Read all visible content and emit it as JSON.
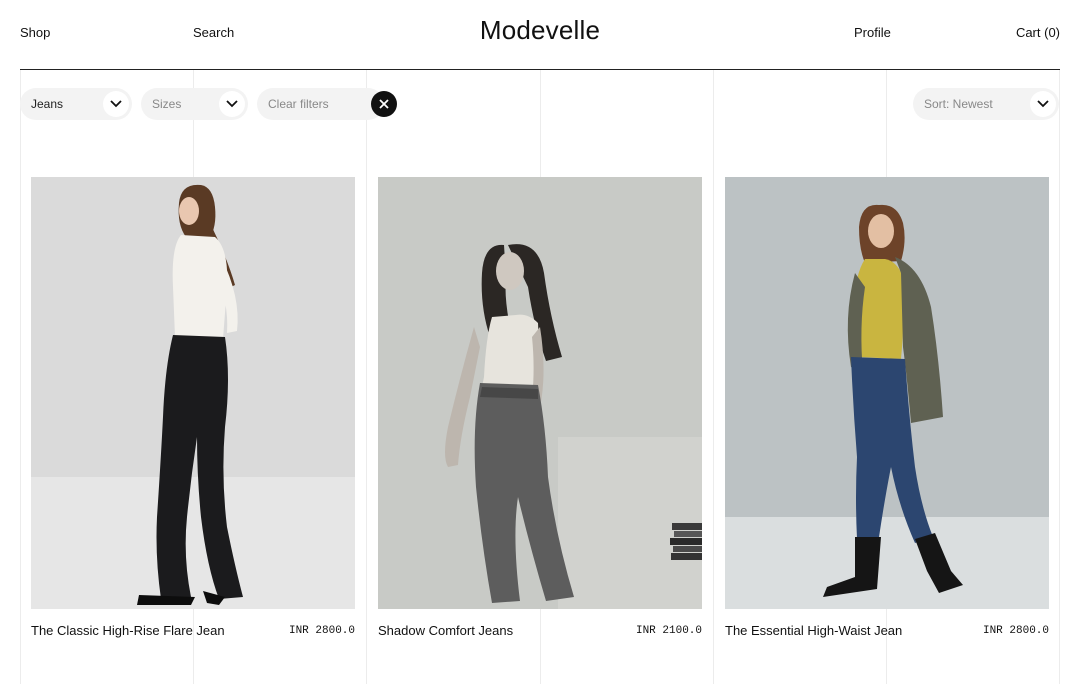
{
  "header": {
    "nav_left": [
      "Shop",
      "Search"
    ],
    "brand": "Modevelle",
    "profile": "Profile",
    "cart": "Cart (0)"
  },
  "filters": {
    "category": {
      "value": "Jeans",
      "icon": "chevron-down-icon"
    },
    "sizes": {
      "placeholder": "Sizes",
      "icon": "chevron-down-icon"
    },
    "clear": {
      "label": "Clear filters",
      "icon": "close-icon"
    },
    "sort": {
      "value": "Sort: Newest",
      "icon": "chevron-down-icon"
    }
  },
  "products": [
    {
      "name": "The Classic High-Rise Flare Jean",
      "price": "INR 2800.0",
      "image": "model in white turtleneck and black flare jeans, grey studio backdrop"
    },
    {
      "name": "Shadow Comfort Jeans",
      "price": "INR 2100.0",
      "image": "black-and-white photo of model leaning on wall in tank top and washed jeans"
    },
    {
      "name": "The Essential High-Waist Jean",
      "price": "INR 2800.0",
      "image": "model in mustard turtleneck, olive blazer and dark blue jeans"
    }
  ],
  "colors": {
    "background": "#ffffff",
    "text": "#111111",
    "pill": "#f3f3f3",
    "photo_bg_1": "#d9d9d9",
    "photo_bg_2": "#c9cbc7",
    "photo_bg_3": "#bdc3c5",
    "denim_blue": "#2c4670",
    "mustard": "#c9b540",
    "olive": "#5f6152"
  }
}
